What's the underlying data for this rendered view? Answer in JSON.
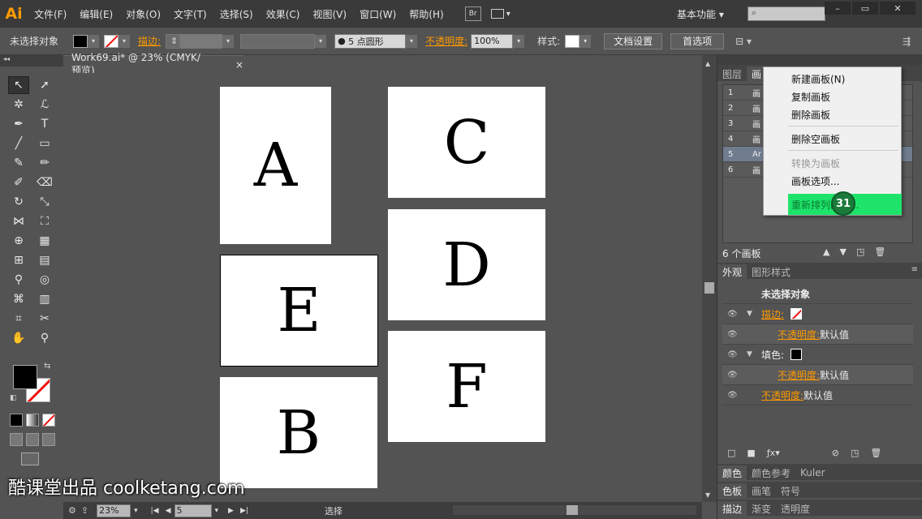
{
  "app": {
    "logo": "Ai",
    "menu": [
      "文件(F)",
      "编辑(E)",
      "对象(O)",
      "文字(T)",
      "选择(S)",
      "效果(C)",
      "视图(V)",
      "窗口(W)",
      "帮助(H)"
    ],
    "bridge_label": "Br",
    "workspace": "基本功能",
    "workspace_arrow": "▾",
    "search_placeholder": "",
    "win_min": "–",
    "win_max": "▭",
    "win_close": "✕"
  },
  "control_bar": {
    "selection": "未选择对象",
    "stroke_label": "描边:",
    "brush_value": "5 点圆形",
    "opacity_label": "不透明度:",
    "opacity_value": "100%",
    "style_label": "样式:",
    "doc_setup": "文档设置",
    "preferences": "首选项",
    "fill_color": "#000000"
  },
  "document": {
    "tab_title": "Work69.ai* @ 23% (CMYK/预览)",
    "tab_close": "×"
  },
  "artboards": [
    {
      "label": "A"
    },
    {
      "label": "C"
    },
    {
      "label": "D"
    },
    {
      "label": "E"
    },
    {
      "label": "F"
    },
    {
      "label": "B"
    }
  ],
  "status_bar": {
    "zoom": "23%",
    "artboard_num": "5",
    "tool": "选择"
  },
  "right_panel": {
    "top_tabs": [
      "图层",
      "画"
    ],
    "artboard_rows": [
      {
        "num": "1",
        "name": "画"
      },
      {
        "num": "2",
        "name": "画"
      },
      {
        "num": "3",
        "name": "画"
      },
      {
        "num": "4",
        "name": "画"
      },
      {
        "num": "5",
        "name": "Ar"
      },
      {
        "num": "6",
        "name": "画"
      }
    ],
    "artboard_count": "6 个画板",
    "appearance_tabs": [
      "外观",
      "图形样式"
    ],
    "appearance_title": "未选择对象",
    "ap_stroke_label": "描边:",
    "ap_opacity_label": "不透明度:",
    "ap_default": "默认值",
    "ap_fill_label": "填色:",
    "bottom_tabs_1": [
      "颜色",
      "颜色参考",
      "Kuler"
    ],
    "bottom_tabs_2": [
      "色板",
      "画笔",
      "符号"
    ],
    "bottom_tabs_3": [
      "描边",
      "渐变",
      "透明度"
    ]
  },
  "context_menu": {
    "items": [
      "新建画板(N)",
      "复制画板",
      "删除画板",
      "删除空画板",
      "转换为画板",
      "画板选项...",
      "重新排列画板..."
    ],
    "badge": "31"
  },
  "watermark": "酷课堂出品 coolketang.com"
}
